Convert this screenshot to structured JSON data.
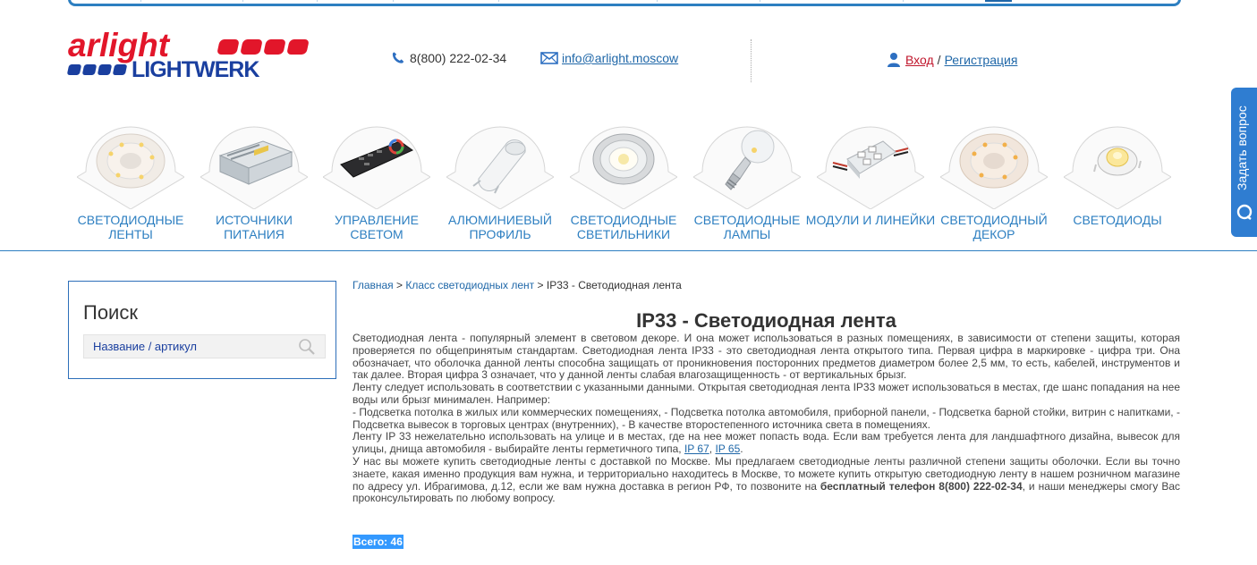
{
  "header": {
    "phone": "8(800) 222-02-34",
    "email": "info@arlight.moscow",
    "login_label": "Вход",
    "login_sep": "/",
    "register_label": "Регистрация",
    "logo": {
      "brand_top": "arlight",
      "brand_bottom": "LIGHTWERK"
    }
  },
  "ask_tab": {
    "label": "Задать вопрос"
  },
  "categories": [
    {
      "label": "Светодиодные ленты",
      "icon": "led-strip-reel-icon"
    },
    {
      "label": "Источники питания",
      "icon": "power-supply-icon"
    },
    {
      "label": "Управление светом",
      "icon": "remote-control-icon"
    },
    {
      "label": "Алюминиевый профиль",
      "icon": "aluminum-profile-icon"
    },
    {
      "label": "Светодиодные светильники",
      "icon": "downlight-icon"
    },
    {
      "label": "Светодиодные лампы",
      "icon": "led-bulb-icon"
    },
    {
      "label": "Модули и линейки",
      "icon": "led-module-icon"
    },
    {
      "label": "Светодиодный декор",
      "icon": "decor-reel-icon"
    },
    {
      "label": "Светодиоды",
      "icon": "single-led-icon"
    }
  ],
  "search": {
    "title": "Поиск",
    "placeholder": "Название / артикул"
  },
  "breadcrumb": {
    "home": "Главная",
    "sep": ">",
    "class": "Класс светодиодных лент",
    "current": "IP33 - Светодиодная лента"
  },
  "page": {
    "title": "IP33 - Светодиодная лента",
    "p1": "Светодиодная лента - популярный элемент в световом декоре. И она может использоваться в разных помещениях, в зависимости от степени защиты, которая проверяется по общепринятым стандартам. Светодиодная лента IP33 - это светодиодная лента открытого типа. Первая цифра в маркировке - цифра три. Она обозначает, что оболочка данной ленты способна защищать от проникновения посторонних предметов диаметром более 2,5 мм, то есть, кабелей, инструментов и так далее. Вторая цифра 3 означает, что у данной ленты слабая влагозащищенность - от вертикальных брызг.",
    "p2": "Ленту следует использовать в соответствии с указанными данными. Открытая светодиодная лента IP33 может использоваться в местах, где шанс попадания на нее воды или брызг минимален. Например:",
    "p3": "- Подсветка потолка в жилых или коммерческих помещениях, - Подсветка потолка автомобиля, приборной панели, - Подсветка барной стойки, витрин с напитками, - Подсветка вывесок в торговых центрах (внутренних), - В качестве второстепенного источника света в помещениях.",
    "p4_a": "Ленту IP 33 нежелательно использовать на улице и в местах, где на нее может попасть вода. Если вам требуется лента для ландшафтного дизайна, вывесок для улицы, днища автомобиля - выбирайте ленты герметичного типа, ",
    "link_ip67": "IP 67",
    "p4_sep": ", ",
    "link_ip65": "IP 65",
    "p4_end": ".",
    "p5_a": "У нас вы можете купить светодиодные ленты с доставкой по Москве. Мы предлагаем светодиодные ленты различной степени защиты оболочки. Если вы точно знаете, какая именно продукция вам нужна, и территориально находитесь в Москве, то можете купить открытую светодиодную ленту в нашем розничном магазине по адресу ул. Ибрагимова, д.12, если же вам нужна доставка в регион РФ, то позвоните на ",
    "p5_bold": "бесплатный телефон 8(800) 222-02-34",
    "p5_b": ", и наши менеджеры смогу Вас проконсультировать по любому вопросу.",
    "total": "Всего: 46"
  },
  "colors": {
    "brand_red": "#e2162a",
    "brand_blue": "#1a3f9f",
    "link_blue": "#1f67a8",
    "accent": "#2d7fc1"
  }
}
